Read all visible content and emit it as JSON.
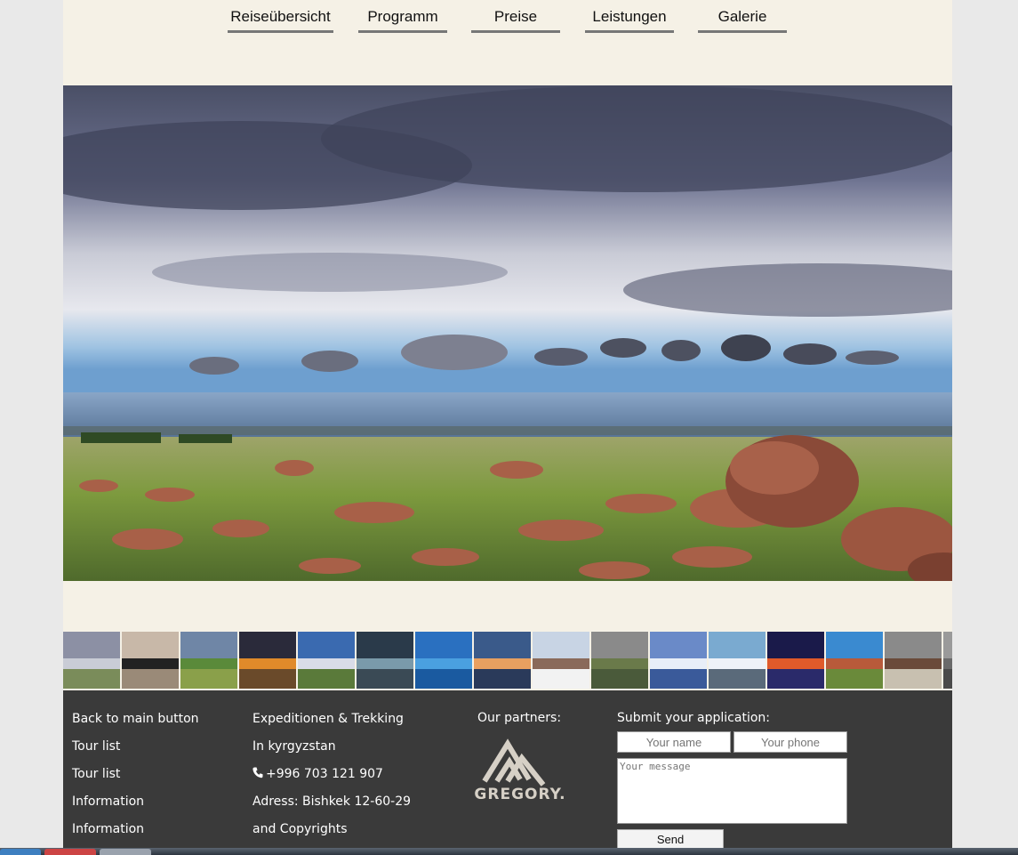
{
  "nav": {
    "items": [
      {
        "label": "Reiseübersicht"
      },
      {
        "label": "Programm"
      },
      {
        "label": "Preise"
      },
      {
        "label": "Leistungen"
      },
      {
        "label": "Galerie"
      }
    ]
  },
  "gallery": {
    "thumbnail_count": 16,
    "active_index": 0,
    "accent_color": "#2aa8d8"
  },
  "footer": {
    "links": [
      "Back to main button",
      "Tour list",
      "Tour list",
      "Information",
      "Information"
    ],
    "contact": {
      "line1": "Expeditionen & Trekking",
      "line2": "In kyrgyzstan",
      "phone": "+996 703 121 907",
      "address": "Adress: Bishkek 12-60-29",
      "copyright": "and Copyrights"
    },
    "partners_title": "Our partners:",
    "partner_logo_text": "GREGORY.",
    "form": {
      "title": "Submit your application:",
      "name_placeholder": "Your name",
      "phone_placeholder": "Your phone",
      "message_placeholder": "Your message",
      "send_label": "Send"
    }
  },
  "colors": {
    "page_bg": "#f5f1e6",
    "footer_bg": "#3a3a3a",
    "nav_underline": "#777777"
  }
}
